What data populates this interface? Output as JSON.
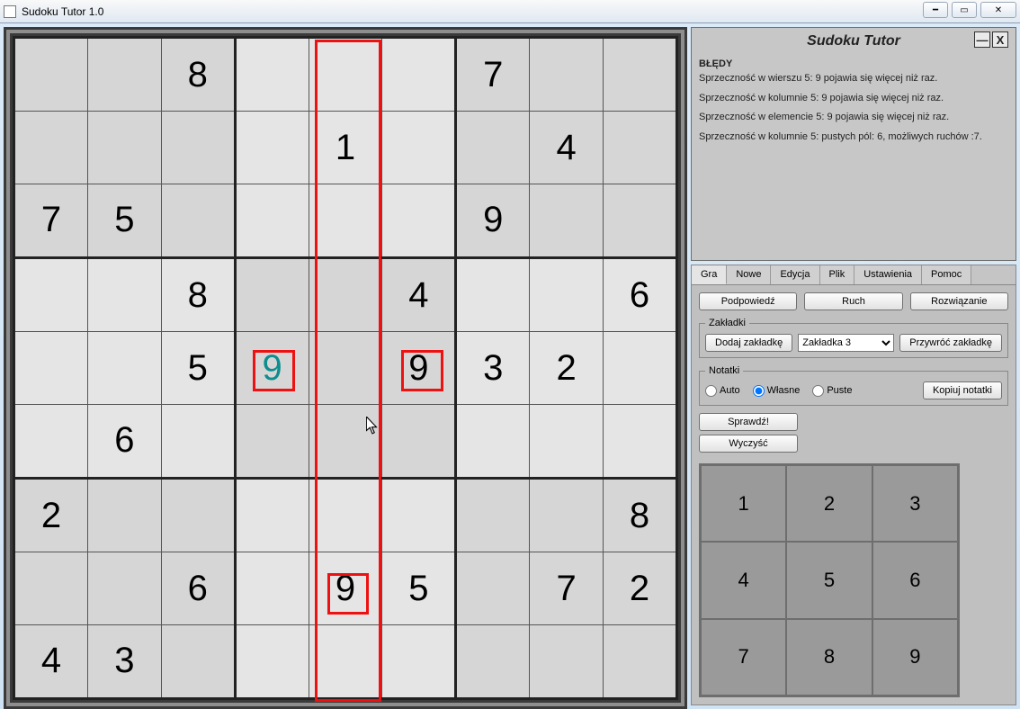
{
  "window": {
    "title": "Sudoku Tutor 1.0"
  },
  "sudoku": {
    "grid": [
      [
        "",
        "",
        "8",
        "",
        "",
        "",
        "7",
        "",
        ""
      ],
      [
        "",
        "",
        "",
        "",
        "1",
        "",
        "",
        "4",
        ""
      ],
      [
        "7",
        "5",
        "",
        "",
        "",
        "",
        "9",
        "",
        ""
      ],
      [
        "",
        "",
        "8",
        "",
        "",
        "4",
        "",
        "",
        "6"
      ],
      [
        "",
        "",
        "5",
        "9",
        "",
        "9",
        "3",
        "2",
        ""
      ],
      [
        "",
        "6",
        "",
        "",
        "",
        "",
        "",
        "",
        ""
      ],
      [
        "2",
        "",
        "",
        "",
        "",
        "",
        "",
        "",
        "8"
      ],
      [
        "",
        "",
        "6",
        "",
        "9",
        "5",
        "",
        "7",
        "2"
      ],
      [
        "4",
        "3",
        "",
        "",
        "",
        "",
        "",
        "",
        ""
      ]
    ],
    "teal_cell": {
      "r": 4,
      "c": 3
    },
    "highlight_column": 4,
    "error_cells": [
      {
        "r": 4,
        "c": 3
      },
      {
        "r": 4,
        "c": 5
      },
      {
        "r": 7,
        "c": 4
      }
    ]
  },
  "info_panel": {
    "title": "Sudoku Tutor",
    "heading": "BŁĘDY",
    "lines": [
      "Sprzeczność w wierszu 5: 9 pojawia się więcej niż raz.",
      "Sprzeczność w kolumnie 5: 9 pojawia się więcej niż raz.",
      "Sprzeczność w elemencie 5: 9 pojawia się więcej niż raz.",
      "Sprzeczność w kolumnie 5: pustych pól: 6, możliwych ruchów :7."
    ]
  },
  "tabs": {
    "items": [
      "Gra",
      "Nowe",
      "Edycja",
      "Plik",
      "Ustawienia",
      "Pomoc"
    ],
    "active": 0
  },
  "controls": {
    "top_buttons": [
      "Podpowiedź",
      "Ruch",
      "Rozwiązanie"
    ],
    "bookmarks": {
      "legend": "Zakładki",
      "add": "Dodaj zakładkę",
      "restore": "Przywróć zakładkę",
      "selected": "Zakładka 3"
    },
    "notes": {
      "legend": "Notatki",
      "options": [
        "Auto",
        "Własne",
        "Puste"
      ],
      "selected": 1,
      "copy": "Kopiuj notatki"
    },
    "check": "Sprawdź!",
    "clear": "Wyczyść"
  },
  "numpad": [
    "1",
    "2",
    "3",
    "4",
    "5",
    "6",
    "7",
    "8",
    "9"
  ]
}
